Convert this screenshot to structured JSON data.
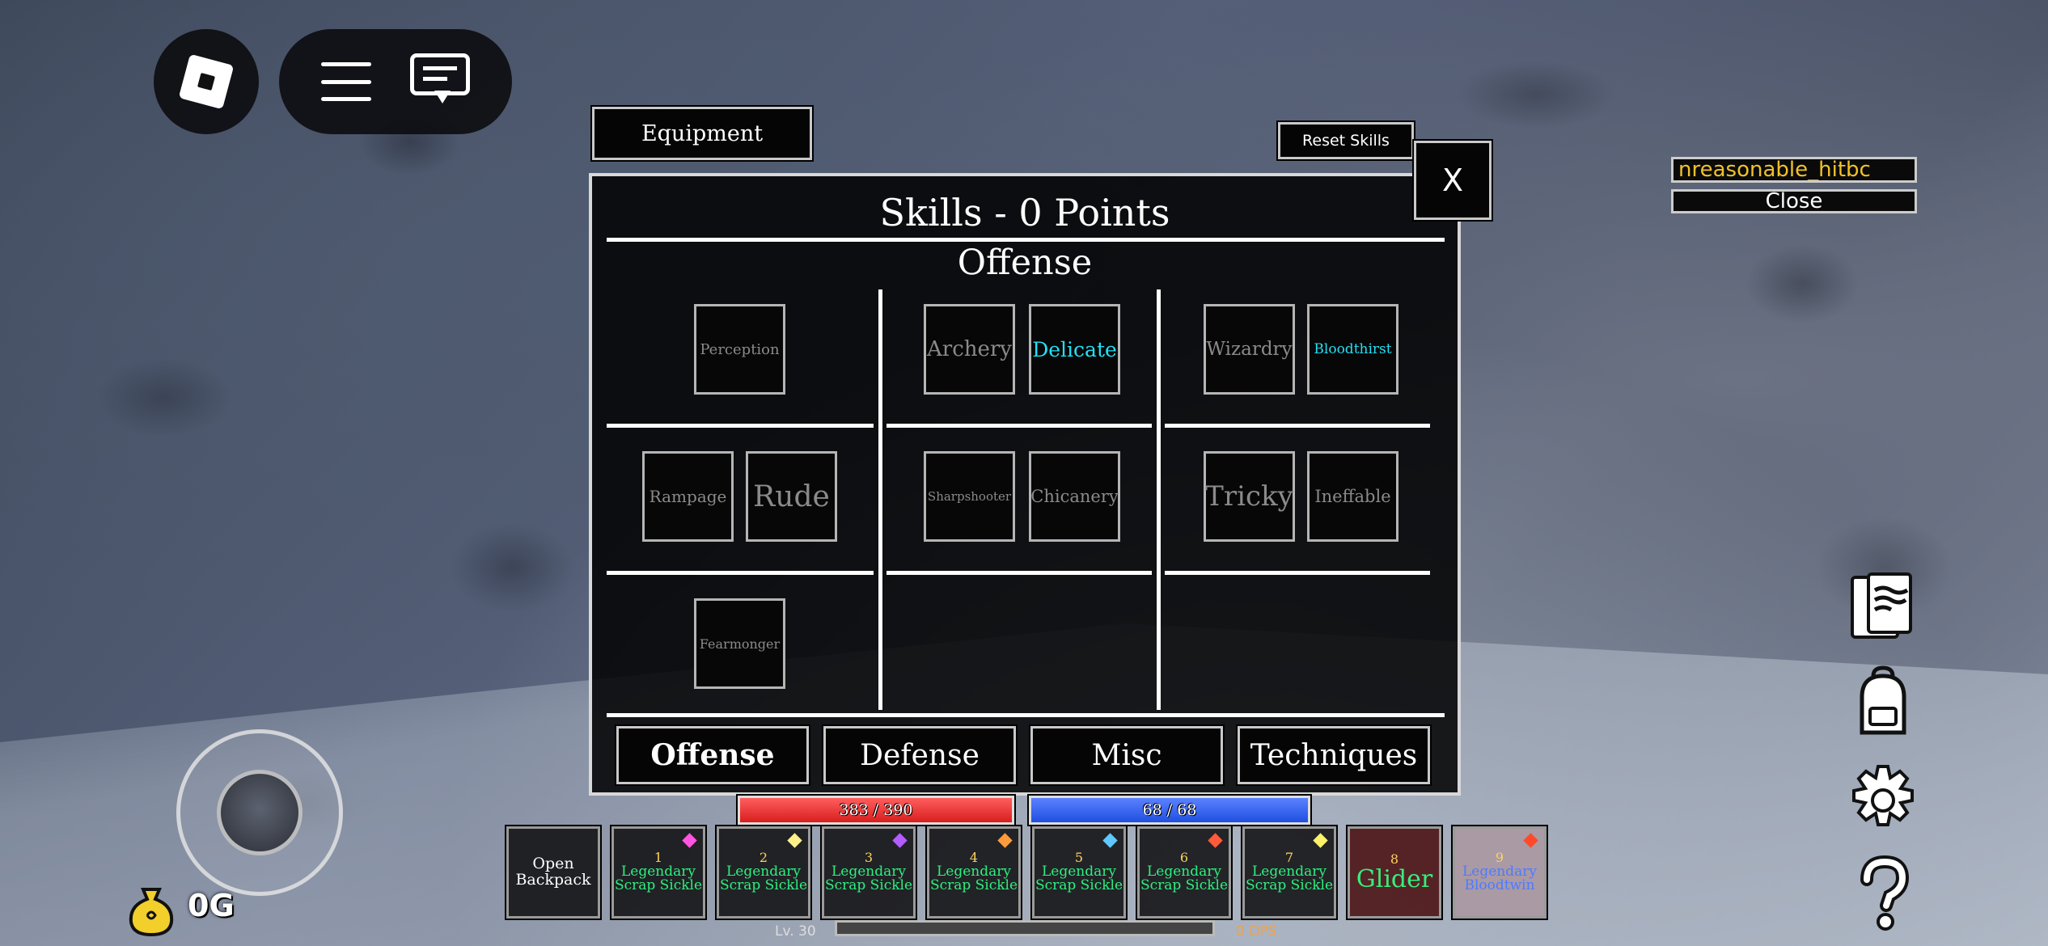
{
  "topbar": {
    "roblox_menu_icon": "roblox-logo-icon",
    "hamburger_icon": "hamburger-menu-icon",
    "chat_icon": "chat-icon"
  },
  "panel": {
    "equipment_label": "Equipment",
    "reset_label": "Reset Skills",
    "close_label": "X",
    "title": "Skills - 0 Points",
    "section_title": "Offense",
    "skills": {
      "perception": "Perception",
      "archery": "Archery",
      "delicate": "Delicate",
      "wizardry": "Wizardry",
      "bloodthirst": "Bloodthirst",
      "rampage": "Rampage",
      "rude": "Rude",
      "sharpshooter": "Sharpshooter",
      "chicanery": "Chicanery",
      "tricky": "Tricky",
      "ineffable": "Ineffable",
      "fearmonger": "Fearmonger"
    },
    "tabs": [
      "Offense",
      "Defense",
      "Misc",
      "Techniques"
    ],
    "selected_tab": "Offense",
    "active_color": "#22e0f5"
  },
  "right": {
    "name_text": "nreasonable_hitbc",
    "close_text": "Close",
    "icons": [
      "journal-icon",
      "backpack-icon",
      "settings-gear-icon",
      "help-question-icon"
    ]
  },
  "stats": {
    "hp_text": "383 / 390",
    "mp_text": "68 / 68",
    "hp_fraction": 0.982,
    "mp_fraction": 1.0,
    "gold": "0G",
    "level": "Lv. 30",
    "dps": "0 DPS"
  },
  "hotbar": {
    "backpack_label": "Open Backpack",
    "slots": [
      {
        "num": "1",
        "name": "Legendary Scrap Sickle",
        "gem": "#ff55e0"
      },
      {
        "num": "2",
        "name": "Legendary Scrap Sickle",
        "gem": "#fff08a"
      },
      {
        "num": "3",
        "name": "Legendary Scrap Sickle",
        "gem": "#b35cff"
      },
      {
        "num": "4",
        "name": "Legendary Scrap Sickle",
        "gem": "#ff9b3d"
      },
      {
        "num": "5",
        "name": "Legendary Scrap Sickle",
        "gem": "#5ec8ff"
      },
      {
        "num": "6",
        "name": "Legendary Scrap Sickle",
        "gem": "#ff5a3c"
      },
      {
        "num": "7",
        "name": "Legendary Scrap Sickle",
        "gem": "#fff06a"
      },
      {
        "num": "8",
        "name": "Glider",
        "gem": ""
      },
      {
        "num": "9",
        "name": "Legendary Bloodtwin",
        "gem": "#ff4a2a"
      }
    ]
  }
}
